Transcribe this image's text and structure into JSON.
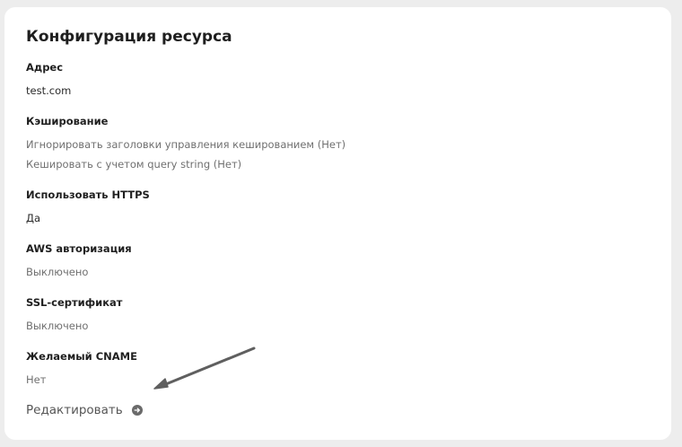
{
  "card": {
    "title": "Конфигурация ресурса",
    "sections": [
      {
        "label": "Адрес",
        "values": [
          "test.com"
        ]
      },
      {
        "label": "Кэширование",
        "values": [
          "Игнорировать заголовки управления кешированием (Нет)",
          "Кешировать с учетом query string (Нет)"
        ]
      },
      {
        "label": "Использовать HTTPS",
        "values": [
          "Да"
        ]
      },
      {
        "label": "AWS авторизация",
        "values": [
          "Выключено"
        ]
      },
      {
        "label": "SSL-сертификат",
        "values": [
          "Выключено"
        ]
      },
      {
        "label": "Желаемый CNAME",
        "values": [
          "Нет"
        ]
      }
    ],
    "edit_label": "Редактировать",
    "edit_icon": "arrow-right-circle-icon"
  },
  "colors": {
    "background": "#ededed",
    "card": "#ffffff",
    "heading": "#1f1f1f",
    "muted": "#707070",
    "annotation_arrow": "#5f5f5f"
  }
}
